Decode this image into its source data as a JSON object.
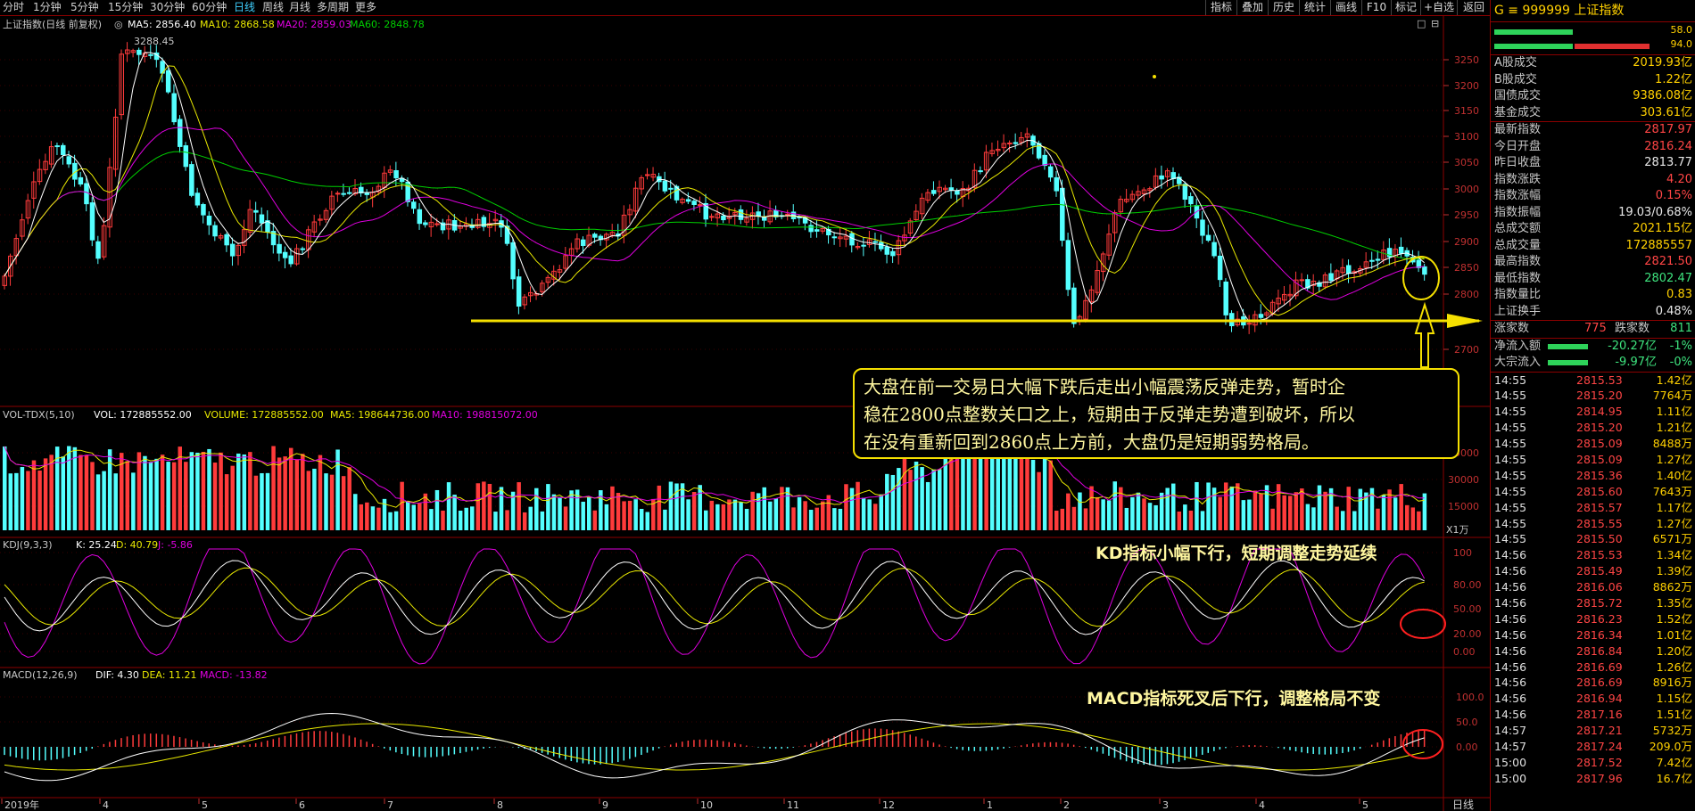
{
  "timeframes": [
    "分时",
    "1分钟",
    "5分钟",
    "15分钟",
    "30分钟",
    "60分钟",
    "日线",
    "周线",
    "月线",
    "多周期",
    "更多"
  ],
  "active_timeframe": "日线",
  "tools": [
    "指标",
    "叠加",
    "历史",
    "统计",
    "画线",
    "F10",
    "标记",
    "+自选",
    "返回"
  ],
  "main_legend": {
    "name": "上证指数(日线 前复权)",
    "ma5": "MA5: 2856.40",
    "ma10": "MA10: 2868.58",
    "ma20": "MA20: 2859.03",
    "ma60": "MA60: 2848.78"
  },
  "high_label": "3288.45",
  "vol_legend": {
    "name": "VOL-TDX(5,10)",
    "vol": "VOL: 172885552.00",
    "volume": "VOLUME: 172885552.00",
    "ma5": "MA5: 198644736.00",
    "ma10": "MA10: 198815072.00"
  },
  "vol_unit": "X1万",
  "kdj_legend": {
    "name": "KDJ(9,3,3)",
    "k": "K: 25.24",
    "d": "D: 40.79",
    "j": "J: -5.86"
  },
  "macd_legend": {
    "name": "MACD(12,26,9)",
    "dif": "DIF: 4.30",
    "dea": "DEA: 11.21",
    "macd": "MACD: -13.82"
  },
  "price_axis": [
    "3250",
    "3200",
    "3150",
    "3100",
    "3050",
    "3000",
    "2950",
    "2900",
    "2850",
    "2800",
    "2700"
  ],
  "vol_axis": [
    "45000",
    "30000",
    "15000"
  ],
  "kdj_axis": [
    "100",
    "80.00",
    "50.00",
    "20.00",
    "0.00"
  ],
  "macd_axis": [
    "100.0",
    "50.0",
    "0.00"
  ],
  "months": [
    "2019年",
    "4",
    "5",
    "6",
    "7",
    "8",
    "9",
    "10",
    "11",
    "12",
    "1",
    "2",
    "3",
    "4",
    "5"
  ],
  "period_label": "日线",
  "callout": [
    "大盘在前一交易日大幅下跌后走出小幅震荡反弹走势，暂时企",
    "稳在2800点整数关口之上，短期由于反弹走势遭到破坏，所以",
    "在没有重新回到2860点上方前，大盘仍是短期弱势格局。"
  ],
  "kd_note": "KD指标小幅下行，短期调整走势延续",
  "macd_note": "MACD指标死叉后下行，调整格局不变",
  "panel": {
    "title": "G ≡ 999999 上证指数",
    "bar_vals": [
      "58.0",
      "94.0"
    ],
    "stats": [
      {
        "k": "A股成交",
        "v": "2019.93亿",
        "c": "yellow"
      },
      {
        "k": "B股成交",
        "v": "1.22亿",
        "c": "yellow"
      },
      {
        "k": "国债成交",
        "v": "9386.08亿",
        "c": "yellow"
      },
      {
        "k": "基金成交",
        "v": "303.61亿",
        "c": "yellow"
      },
      {
        "k": "最新指数",
        "v": "2817.97",
        "c": "red"
      },
      {
        "k": "今日开盘",
        "v": "2816.24",
        "c": "red"
      },
      {
        "k": "昨日收盘",
        "v": "2813.77",
        "c": "white"
      },
      {
        "k": "指数涨跌",
        "v": "4.20",
        "c": "red"
      },
      {
        "k": "指数涨幅",
        "v": "0.15%",
        "c": "red"
      },
      {
        "k": "指数振幅",
        "v": "19.03/0.68%",
        "c": "white"
      },
      {
        "k": "总成交额",
        "v": "2021.15亿",
        "c": "yellow"
      },
      {
        "k": "总成交量",
        "v": "172885557",
        "c": "yellow"
      },
      {
        "k": "最高指数",
        "v": "2821.50",
        "c": "red"
      },
      {
        "k": "最低指数",
        "v": "2802.47",
        "c": "green"
      },
      {
        "k": "指数量比",
        "v": "0.83",
        "c": "yellow"
      },
      {
        "k": "上证换手",
        "v": "0.48%",
        "c": "white"
      }
    ],
    "updown": {
      "up_label": "涨家数",
      "up": "775",
      "down_label": "跌家数",
      "down": "811"
    },
    "flows": [
      {
        "k": "净流入额",
        "v": "-20.27亿",
        "p": "-1%"
      },
      {
        "k": "大宗流入",
        "v": "-9.97亿",
        "p": "-0%"
      }
    ],
    "ticks": [
      [
        "14:55",
        "2815.53",
        "1.42亿",
        "y"
      ],
      [
        "14:55",
        "2815.20",
        "7764万",
        "y"
      ],
      [
        "14:55",
        "2814.95",
        "1.11亿",
        "y"
      ],
      [
        "14:55",
        "2815.20",
        "1.21亿",
        "y"
      ],
      [
        "14:55",
        "2815.09",
        "8488万",
        "y"
      ],
      [
        "14:55",
        "2815.09",
        "1.27亿",
        "y"
      ],
      [
        "14:55",
        "2815.36",
        "1.40亿",
        "y"
      ],
      [
        "14:55",
        "2815.60",
        "7643万",
        "y"
      ],
      [
        "14:55",
        "2815.57",
        "1.17亿",
        "y"
      ],
      [
        "14:55",
        "2815.55",
        "1.27亿",
        "y"
      ],
      [
        "14:55",
        "2815.50",
        "6571万",
        "y"
      ],
      [
        "14:56",
        "2815.53",
        "1.34亿",
        "y"
      ],
      [
        "14:56",
        "2815.49",
        "1.39亿",
        "y"
      ],
      [
        "14:56",
        "2816.06",
        "8862万",
        "y"
      ],
      [
        "14:56",
        "2815.72",
        "1.35亿",
        "y"
      ],
      [
        "14:56",
        "2816.23",
        "1.52亿",
        "y"
      ],
      [
        "14:56",
        "2816.34",
        "1.01亿",
        "y"
      ],
      [
        "14:56",
        "2816.84",
        "1.20亿",
        "y"
      ],
      [
        "14:56",
        "2816.69",
        "1.26亿",
        "y"
      ],
      [
        "14:56",
        "2816.69",
        "8916万",
        "y"
      ],
      [
        "14:56",
        "2816.94",
        "1.15亿",
        "y"
      ],
      [
        "14:56",
        "2817.16",
        "1.51亿",
        "y"
      ],
      [
        "14:57",
        "2817.21",
        "5732万",
        "y"
      ],
      [
        "14:57",
        "2817.24",
        "209.0万",
        "y"
      ],
      [
        "15:00",
        "2817.52",
        "7.42亿",
        "y"
      ],
      [
        "15:00",
        "2817.96",
        "16.7亿",
        "y"
      ]
    ]
  },
  "colors": {
    "up": "#ff3b3b",
    "down": "#54ffff",
    "ma5": "#ffffff",
    "ma10": "#e8e800",
    "ma20": "#e000e0",
    "ma60": "#00d000",
    "grid": "#8b0000",
    "axis": "#c03030"
  }
}
